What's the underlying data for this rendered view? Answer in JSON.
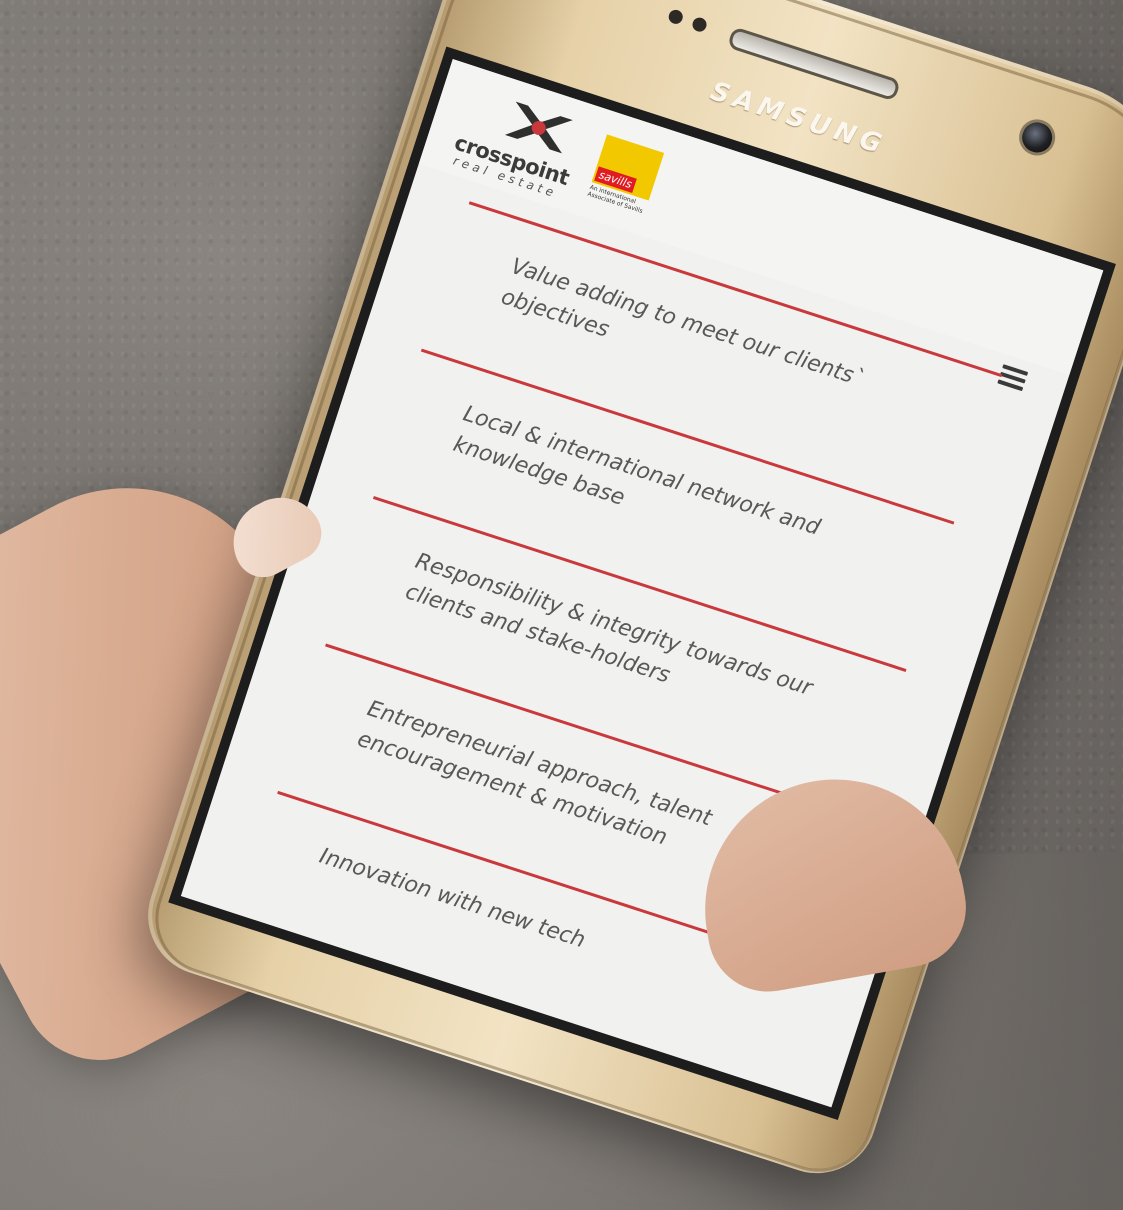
{
  "device": {
    "brand": "SAMSUNG"
  },
  "site": {
    "logo_primary": {
      "name": "crosspoint",
      "subtitle": "real estate"
    },
    "logo_partner": {
      "name": "savills",
      "subtitle": "An international Associate of Savills"
    }
  },
  "menu": {
    "icon": "hamburger-icon"
  },
  "values": [
    "Value adding to meet our clients` objectives",
    "Local & international network and knowledge base",
    "Responsibility & integrity towards our clients and stake-holders",
    "Entrepreneurial approach, talent encouragement & motivation",
    "Innovation with new tech"
  ],
  "colors": {
    "accent": "#c9393c",
    "savills_yellow": "#f2c800",
    "savills_red": "#e11b22",
    "phone_gold": "#e6d1a8"
  }
}
